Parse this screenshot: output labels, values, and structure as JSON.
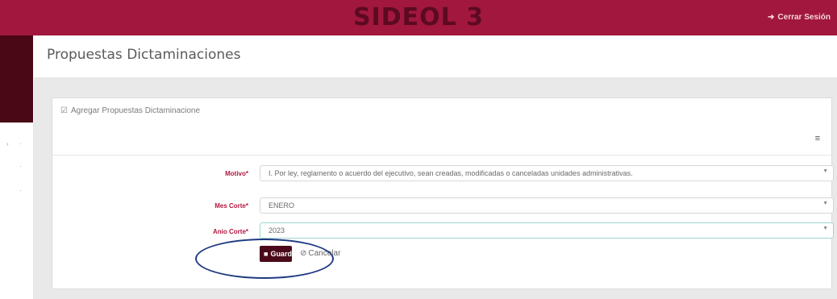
{
  "header": {
    "brand": "SIDEOL 3",
    "logout_icon": "sign-out-icon",
    "logout_label": "Cerrar Sesión"
  },
  "page": {
    "title": "Propuestas Dictaminaciones"
  },
  "card": {
    "title_icon": "edit-icon",
    "title": "Agregar Propuestas Dictaminacione",
    "menu_icon": "menu-icon"
  },
  "form": {
    "motivo": {
      "label": "Motivo*",
      "value": "I. Por ley, reglamento o acuerdo del ejecutivo, sean creadas, modificadas o canceladas unidades administrativas."
    },
    "mes_corte": {
      "label": "Mes Corte*",
      "value": "ENERO"
    },
    "anio_corte": {
      "label": "Anio Corte*",
      "value": "2023"
    }
  },
  "actions": {
    "save_icon": "save-icon",
    "save_label": "Guardar",
    "cancel_icon": "cancel-icon",
    "cancel_label": "Cancelar"
  },
  "colors": {
    "brand": "#a1173d",
    "sidebar": "#4a0716",
    "label": "#b3163f",
    "save_button": "#4b0a1a",
    "highlight": "#1f3a82"
  }
}
